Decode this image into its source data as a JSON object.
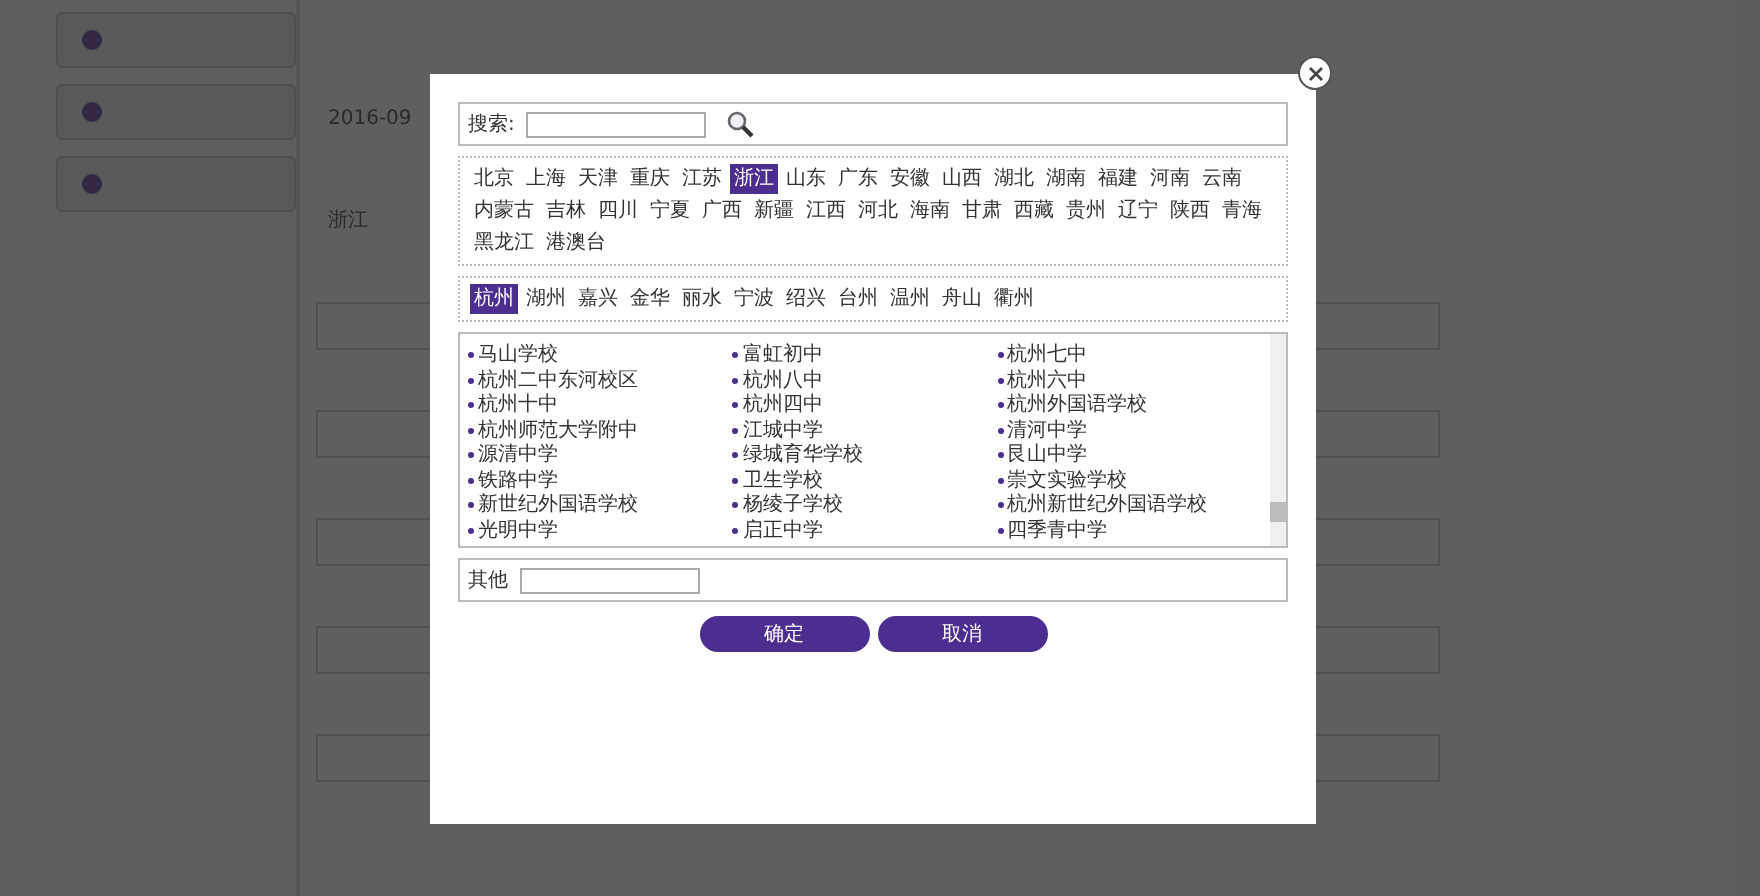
{
  "background": {
    "fields": [
      {
        "value": "2016-09"
      },
      {
        "value": "浙江"
      }
    ]
  },
  "dialog": {
    "search": {
      "label": "搜索:"
    },
    "provinces": [
      {
        "label": "北京",
        "selected": false
      },
      {
        "label": "上海",
        "selected": false
      },
      {
        "label": "天津",
        "selected": false
      },
      {
        "label": "重庆",
        "selected": false
      },
      {
        "label": "江苏",
        "selected": false
      },
      {
        "label": "浙江",
        "selected": true
      },
      {
        "label": "山东",
        "selected": false
      },
      {
        "label": "广东",
        "selected": false
      },
      {
        "label": "安徽",
        "selected": false
      },
      {
        "label": "山西",
        "selected": false
      },
      {
        "label": "湖北",
        "selected": false
      },
      {
        "label": "湖南",
        "selected": false
      },
      {
        "label": "福建",
        "selected": false
      },
      {
        "label": "河南",
        "selected": false
      },
      {
        "label": "云南",
        "selected": false
      },
      {
        "label": "内蒙古",
        "selected": false
      },
      {
        "label": "吉林",
        "selected": false
      },
      {
        "label": "四川",
        "selected": false
      },
      {
        "label": "宁夏",
        "selected": false
      },
      {
        "label": "广西",
        "selected": false
      },
      {
        "label": "新疆",
        "selected": false
      },
      {
        "label": "江西",
        "selected": false
      },
      {
        "label": "河北",
        "selected": false
      },
      {
        "label": "海南",
        "selected": false
      },
      {
        "label": "甘肃",
        "selected": false
      },
      {
        "label": "西藏",
        "selected": false
      },
      {
        "label": "贵州",
        "selected": false
      },
      {
        "label": "辽宁",
        "selected": false
      },
      {
        "label": "陕西",
        "selected": false
      },
      {
        "label": "青海",
        "selected": false
      },
      {
        "label": "黑龙江",
        "selected": false
      },
      {
        "label": "港澳台",
        "selected": false
      }
    ],
    "cities": [
      {
        "label": "杭州",
        "selected": true
      },
      {
        "label": "湖州",
        "selected": false
      },
      {
        "label": "嘉兴",
        "selected": false
      },
      {
        "label": "金华",
        "selected": false
      },
      {
        "label": "丽水",
        "selected": false
      },
      {
        "label": "宁波",
        "selected": false
      },
      {
        "label": "绍兴",
        "selected": false
      },
      {
        "label": "台州",
        "selected": false
      },
      {
        "label": "温州",
        "selected": false
      },
      {
        "label": "舟山",
        "selected": false
      },
      {
        "label": "衢州",
        "selected": false
      }
    ],
    "schools": [
      "马山学校",
      "富虹初中",
      "杭州七中",
      "杭州二中东河校区",
      "杭州八中",
      "杭州六中",
      "杭州十中",
      "杭州四中",
      "杭州外国语学校",
      "杭州师范大学附中",
      "江城中学",
      "清河中学",
      "源清中学",
      "绿城育华学校",
      "艮山中学",
      "铁路中学",
      "卫生学校",
      "崇文实验学校",
      "新世纪外国语学校",
      "杨绫子学校",
      "杭州新世纪外国语学校",
      "光明中学",
      "启正中学",
      "四季青中学"
    ],
    "other": {
      "label": "其他"
    },
    "buttons": [
      "确定",
      "取消"
    ]
  }
}
